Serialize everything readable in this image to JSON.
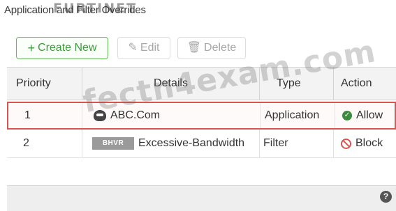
{
  "header": {
    "title": "Application and Filter Overrides",
    "brand_logo": "FURTINET"
  },
  "toolbar": {
    "create_label": "Create New",
    "create_icon": "plus-icon",
    "edit_label": "Edit",
    "edit_icon": "pencil-icon",
    "delete_label": "Delete",
    "delete_icon": "trash-icon"
  },
  "table": {
    "columns": [
      "Priority",
      "Details",
      "Type",
      "Action"
    ],
    "rows": [
      {
        "priority": "1",
        "details": "ABC.Com",
        "details_icon": "application-icon",
        "type": "Application",
        "action": "Allow",
        "action_icon": "check-circle-icon",
        "selected": true
      },
      {
        "priority": "2",
        "badge": "BHVR",
        "details": "Excessive-Bandwidth",
        "type": "Filter",
        "action": "Block",
        "action_icon": "block-icon",
        "selected": false
      }
    ]
  },
  "footer": {
    "help_icon": "help-icon",
    "help_glyph": "?"
  },
  "watermark": "fectn4exam.com",
  "colors": {
    "accent_green": "#3e9a3c",
    "selection_red": "#d9534f",
    "allow_green": "#3d8b3d",
    "block_red": "#d9534f",
    "header_bg": "#f3f3f3"
  }
}
